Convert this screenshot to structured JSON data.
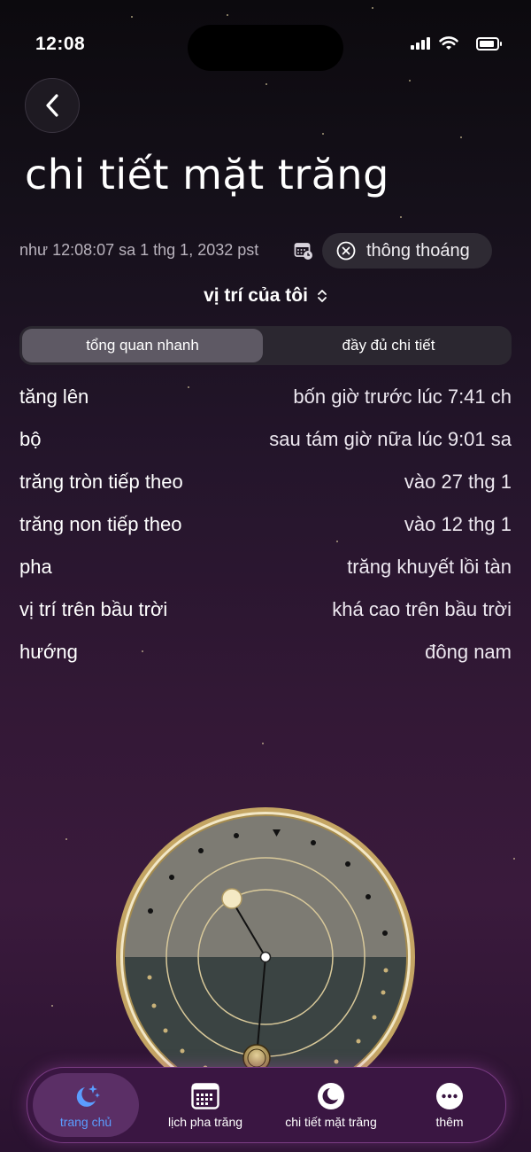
{
  "status_bar": {
    "time": "12:08"
  },
  "header": {
    "title": "chi tiết mặt trăng",
    "timestamp": "như 12:08:07 sa 1 thg 1, 2032 pst",
    "weather_label": "thông thoáng",
    "location": "vị trí của tôi"
  },
  "segments": {
    "quick": "tổng quan nhanh",
    "full": "đầy đủ chi tiết",
    "selected": "quick"
  },
  "details": [
    {
      "label": "tăng lên",
      "value": "bốn giờ trước lúc 7:41 ch"
    },
    {
      "label": "bộ",
      "value": "sau tám giờ nữa lúc 9:01 sa"
    },
    {
      "label": "trăng tròn tiếp theo",
      "value": "vào 27 thg 1"
    },
    {
      "label": "trăng non tiếp theo",
      "value": "vào 12 thg 1"
    },
    {
      "label": "pha",
      "value": "trăng khuyết lồi tàn"
    },
    {
      "label": "vị trí trên bầu trời",
      "value": "khá cao trên bầu trời"
    },
    {
      "label": "hướng",
      "value": "đông nam"
    }
  ],
  "tabbar": {
    "home": "trang chủ",
    "calendar": "lịch pha trăng",
    "detail": "chi tiết mặt trăng",
    "more": "thêm",
    "active": "home"
  },
  "colors": {
    "accent": "#5b9dff",
    "gold": "#b89b56",
    "sky": "#7c7a72",
    "ground": "#3c4443"
  },
  "icons": [
    "back-chevron-icon",
    "calendar-clock-icon",
    "close-circle-icon",
    "chevron-updown-icon",
    "moon-stars-icon",
    "calendar-grid-icon",
    "moon-circle-icon",
    "ellipsis-circle-icon"
  ]
}
